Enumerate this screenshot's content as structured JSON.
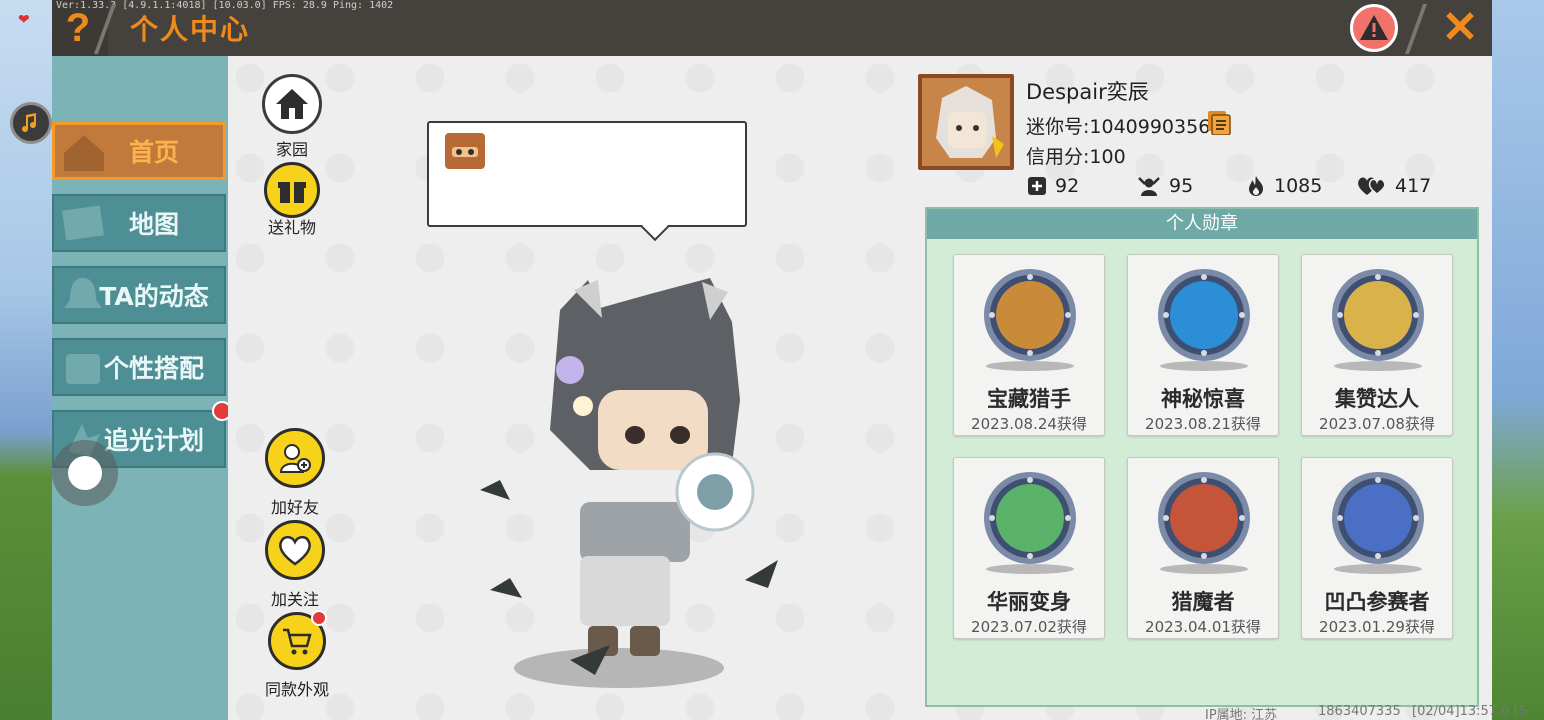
{
  "header": {
    "title": "个人中心",
    "help_icon": "?",
    "close_icon": "✕",
    "debug": "Ver:1.33.3 [4.9.1.1:4018] [10.03.0] FPS: 28.9 Ping: 1402"
  },
  "sidenav": {
    "items": [
      {
        "label": "首页",
        "active": true
      },
      {
        "label": "地图",
        "active": false
      },
      {
        "label": "TA的动态",
        "active": false
      },
      {
        "label": "个性搭配",
        "active": false
      },
      {
        "label": "追光计划",
        "active": false
      }
    ]
  },
  "actions": {
    "home": "家园",
    "gift": "送礼物",
    "add_friend": "加好友",
    "follow": "加关注",
    "same_outfit": "同款外观"
  },
  "profile": {
    "username": "Despair奕辰",
    "mini_id": "迷你号:1040990356",
    "credit": "信用分:100",
    "stats": {
      "likes": "92",
      "fans": "95",
      "popularity": "1085",
      "hearts": "417"
    }
  },
  "medals": {
    "title": "个人勋章",
    "items": [
      {
        "name": "宝藏猎手",
        "date": "2023.08.24获得",
        "color": "#c98a3a"
      },
      {
        "name": "神秘惊喜",
        "date": "2023.08.21获得",
        "color": "#2c8fd6"
      },
      {
        "name": "集赞达人",
        "date": "2023.07.08获得",
        "color": "#d9b24a"
      },
      {
        "name": "华丽变身",
        "date": "2023.07.02获得",
        "color": "#5bb36a"
      },
      {
        "name": "猎魔者",
        "date": "2023.04.01获得",
        "color": "#c4553a"
      },
      {
        "name": "凹凸参赛者",
        "date": "2023.01.29获得",
        "color": "#4a6fc4"
      }
    ]
  },
  "footer": {
    "ip_location": "IP属地: 江苏",
    "uid": "1863407335",
    "timestamp": "[02/04]13:57.0 [5"
  }
}
